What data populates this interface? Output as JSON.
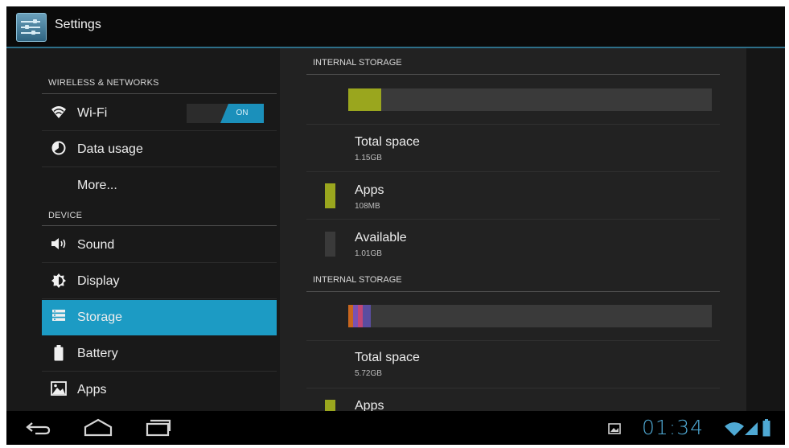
{
  "app": {
    "title": "Settings",
    "icon": "settings-icon"
  },
  "sidebar": {
    "sections": [
      {
        "header": "WIRELESS & NETWORKS"
      },
      {
        "header": "DEVICE"
      }
    ],
    "items": [
      {
        "label": "Wi-Fi",
        "icon": "wifi-icon",
        "toggle": "ON"
      },
      {
        "label": "Data usage",
        "icon": "data-usage-icon"
      },
      {
        "label": "More..."
      },
      {
        "label": "Sound",
        "icon": "speaker-icon"
      },
      {
        "label": "Display",
        "icon": "display-icon"
      },
      {
        "label": "Storage",
        "icon": "storage-icon",
        "selected": true
      },
      {
        "label": "Battery",
        "icon": "battery-icon"
      },
      {
        "label": "Apps",
        "icon": "apps-icon"
      }
    ]
  },
  "storage": {
    "internal": {
      "header": "INTERNAL STORAGE",
      "used_fraction": 0.09,
      "total_label": "Total space",
      "total_value": "1.15GB",
      "apps_label": "Apps",
      "apps_value": "108MB",
      "available_label": "Available",
      "available_value": "1.01GB"
    },
    "second": {
      "header": "INTERNAL STORAGE",
      "total_label": "Total space",
      "total_value": "5.72GB",
      "apps_label": "Apps"
    }
  },
  "colors": {
    "accent": "#1c9bc4",
    "apps": "#9aa61e",
    "clock": "#4fa9d4"
  },
  "status": {
    "time": "01:34"
  },
  "nav": {
    "back": "back-icon",
    "home": "home-icon",
    "recents": "recents-icon"
  }
}
